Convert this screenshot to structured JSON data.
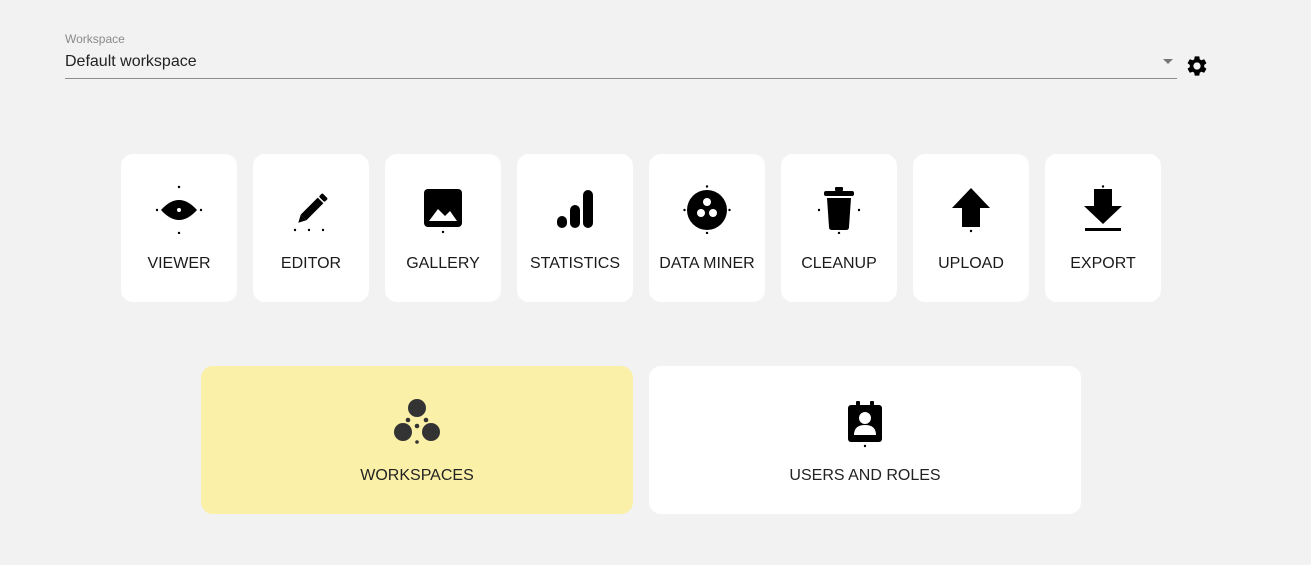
{
  "workspace": {
    "label": "Workspace",
    "value": "Default workspace",
    "caret_icon": "caret-down-icon",
    "settings_icon": "gear-icon"
  },
  "tools": [
    {
      "label": "VIEWER",
      "icon": "eye-icon"
    },
    {
      "label": "EDITOR",
      "icon": "pencil-icon"
    },
    {
      "label": "GALLERY",
      "icon": "image-icon"
    },
    {
      "label": "STATISTICS",
      "icon": "bar-chart-icon"
    },
    {
      "label": "DATA MINER",
      "icon": "bowling-ball-icon"
    },
    {
      "label": "CLEANUP",
      "icon": "trash-icon"
    },
    {
      "label": "UPLOAD",
      "icon": "arrow-up-icon"
    },
    {
      "label": "EXPORT",
      "icon": "download-icon"
    }
  ],
  "admin": [
    {
      "label": "WORKSPACES",
      "icon": "workspaces-icon",
      "active": true
    },
    {
      "label": "USERS AND ROLES",
      "icon": "user-badge-icon",
      "active": false
    }
  ],
  "colors": {
    "background": "#f2f2f2",
    "tile": "#ffffff",
    "active_card": "#fbf0a8",
    "icon": "#000000"
  }
}
